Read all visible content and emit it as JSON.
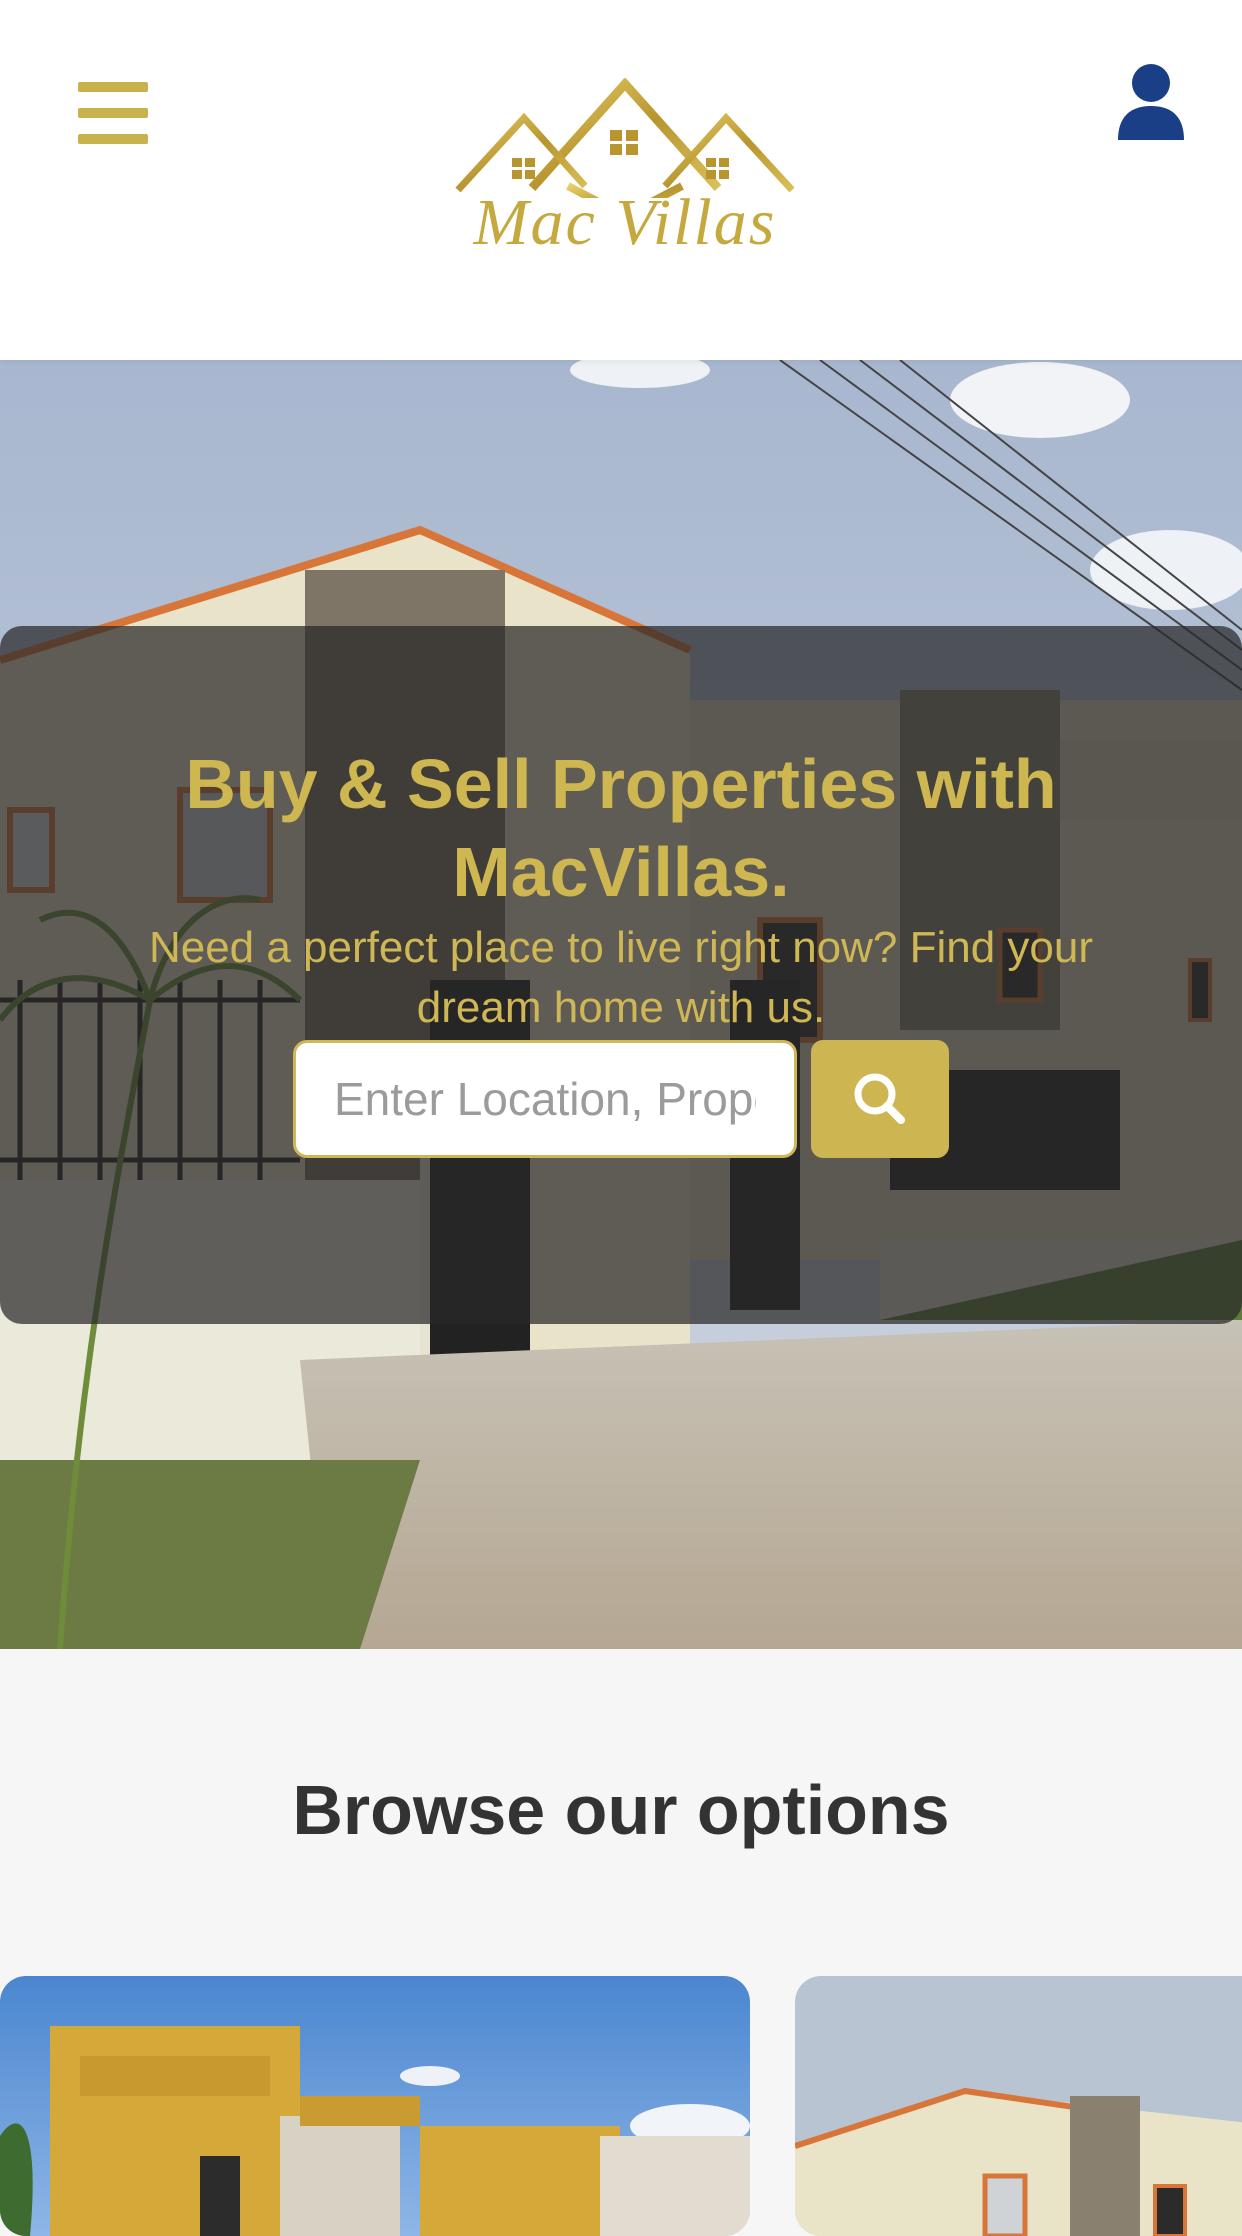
{
  "header": {
    "brand": "Mac Villas"
  },
  "hero": {
    "title": "Buy & Sell Properties with MacVillas.",
    "subtitle": "Need a perfect place to live right now? Find your dream home with us.",
    "search": {
      "placeholder": "Enter Location, Property Type"
    }
  },
  "browse": {
    "title": "Browse our options"
  },
  "colors": {
    "gold": "#c9b14b",
    "user_icon": "#1b3f87",
    "overlay": "#282828",
    "heading": "#333333"
  },
  "icons": {
    "menu": "hamburger-icon",
    "user": "user-icon",
    "search": "search-icon",
    "logo": "house-roof-logo"
  }
}
